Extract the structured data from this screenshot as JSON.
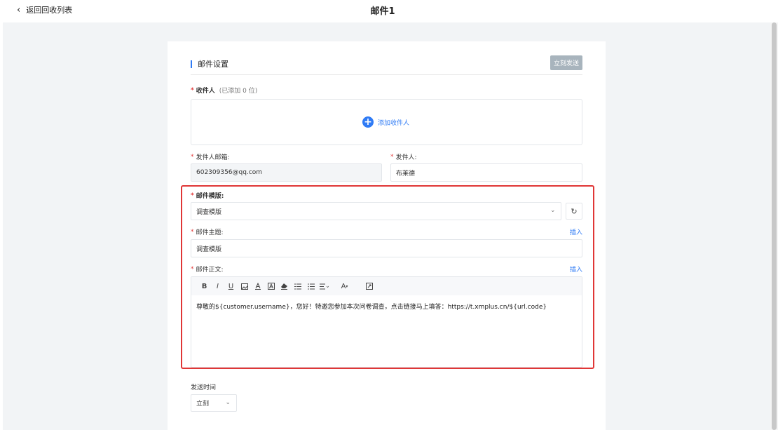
{
  "header": {
    "back_label": "返回回收列表",
    "title": "邮件1"
  },
  "section": {
    "title": "邮件设置",
    "send_now_label": "立刻发送"
  },
  "recipients": {
    "label": "收件人",
    "hint": "(已添加 0 位)",
    "add_label": "添加收件人"
  },
  "sender_email": {
    "label": "发件人邮箱:",
    "value": "602309356@qq.com"
  },
  "sender_name": {
    "label": "发件人:",
    "value": "布莱德"
  },
  "template": {
    "label": "邮件模版:",
    "selected": "调查模版"
  },
  "subject": {
    "label": "邮件主题:",
    "insert_label": "插入",
    "value": "调查模版"
  },
  "body": {
    "label": "邮件正文:",
    "insert_label": "插入",
    "content": "尊敬的${customer.username}，您好！特邀您参加本次问卷调查，点击链接马上填答：https://t.xmplus.cn/${url.code}",
    "toolbar": {
      "bold": "B",
      "italic": "I",
      "underline": "U",
      "font_size": "A"
    }
  },
  "send_time": {
    "label": "发送时间",
    "selected": "立刻"
  },
  "colors": {
    "accent": "#2f7bf5",
    "required": "#e23b3b",
    "highlight": "#e03636",
    "disabled_button": "#a8b4bd"
  }
}
